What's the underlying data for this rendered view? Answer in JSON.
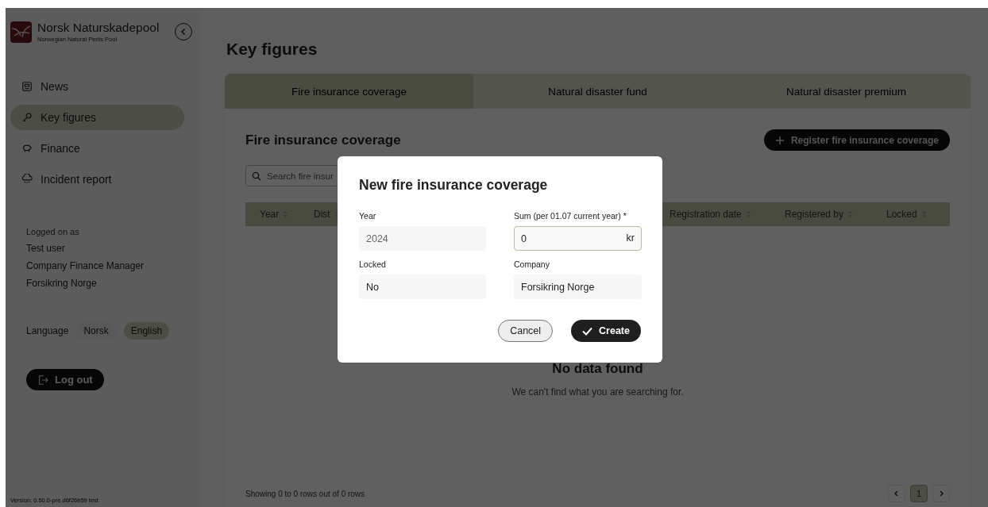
{
  "brand": {
    "name": "Norsk Naturskadepool",
    "subtitle": "Norwegian Natural Perils Pool"
  },
  "sidebar": {
    "items": [
      {
        "label": "News",
        "selected": false
      },
      {
        "label": "Key figures",
        "selected": true
      },
      {
        "label": "Finance",
        "selected": false
      },
      {
        "label": "Incident report",
        "selected": false
      }
    ],
    "user": {
      "heading": "Logged on as",
      "name": "Test user",
      "role": "Company Finance Manager",
      "company": "Forsikring Norge"
    },
    "language": {
      "label": "Language",
      "options": [
        {
          "label": "Norsk",
          "selected": false
        },
        {
          "label": "English",
          "selected": true
        }
      ]
    },
    "logout": "Log out",
    "version": "Version: 0.50.0-pre.d6f26b59 test"
  },
  "page": {
    "title": "Key figures",
    "tabs": [
      {
        "label": "Fire insurance coverage",
        "selected": true
      },
      {
        "label": "Natural disaster fund",
        "selected": false
      },
      {
        "label": "Natural disaster premium",
        "selected": false
      }
    ],
    "section_title": "Fire insurance coverage",
    "register_button": "Register fire insurance coverage",
    "search": {
      "placeholder": "Search fire insur"
    },
    "table": {
      "columns": [
        "Year",
        "Dist",
        "Registration date",
        "Registered by",
        "Locked"
      ]
    },
    "empty": {
      "title": "No data found",
      "text": "We can't find what you are searching for."
    },
    "footer": "Showing 0 to 0 rows out of 0 rows",
    "pagination": {
      "pages": [
        {
          "label": "1",
          "selected": true
        }
      ]
    }
  },
  "modal": {
    "title": "New fire insurance coverage",
    "fields": [
      {
        "kind": "static",
        "label": "Year",
        "value": "2024",
        "disabled": true
      },
      {
        "kind": "input",
        "label": "Sum (per 01.07 current year) *",
        "value": "0",
        "suffix": "kr"
      },
      {
        "kind": "static",
        "label": "Locked",
        "value": "No",
        "disabled": false
      },
      {
        "kind": "static",
        "label": "Company",
        "value": "Forsikring Norge",
        "disabled": false
      }
    ],
    "buttons": [
      {
        "kind": "secondary",
        "label": "Cancel"
      },
      {
        "kind": "primary",
        "label": "Create"
      }
    ]
  }
}
